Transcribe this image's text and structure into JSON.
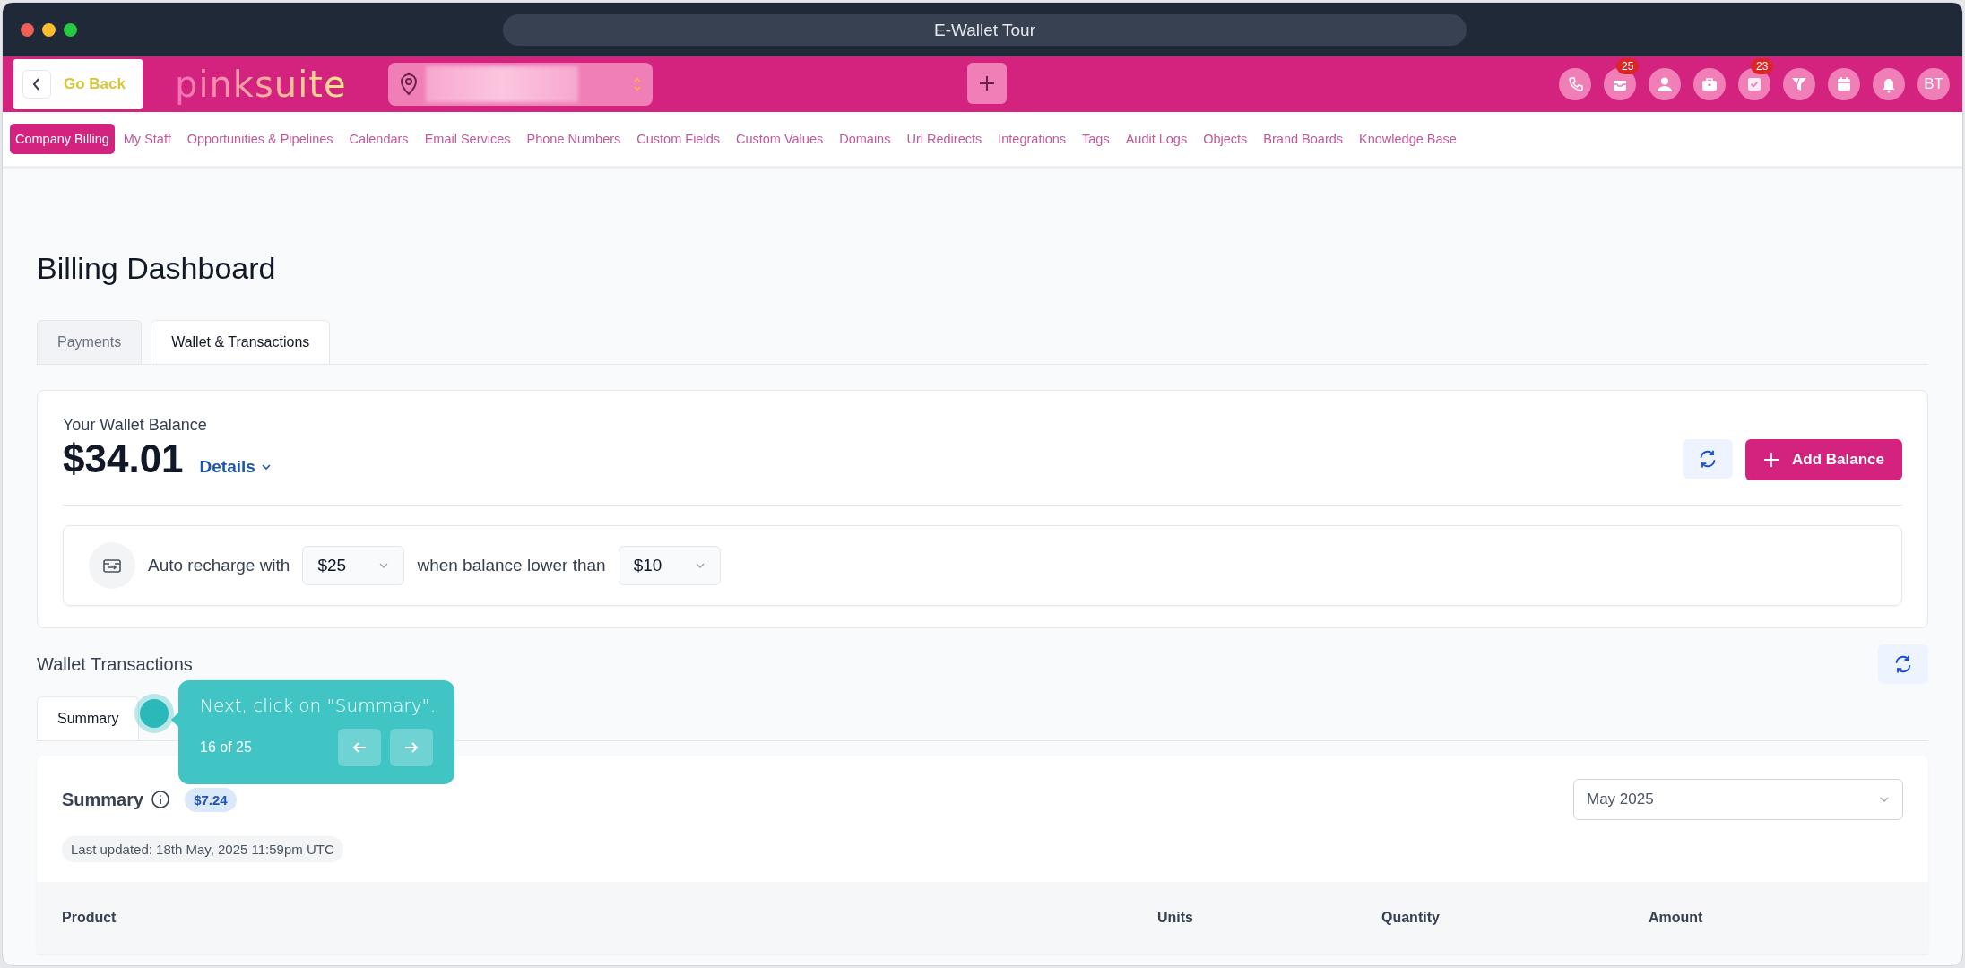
{
  "window": {
    "title": "E-Wallet Tour"
  },
  "header": {
    "back_label": "Go Back",
    "logo": "pinksuite",
    "icons": [
      {
        "kind": "phone"
      },
      {
        "kind": "inbox",
        "badge": "25"
      },
      {
        "kind": "user"
      },
      {
        "kind": "briefcase"
      },
      {
        "kind": "task",
        "badge": "23"
      },
      {
        "kind": "filter"
      },
      {
        "kind": "calendar"
      },
      {
        "kind": "bell"
      }
    ],
    "avatar": "BT"
  },
  "nav": [
    {
      "label": "Company Billing",
      "selected": true
    },
    {
      "label": "My Staff",
      "selected": false
    },
    {
      "label": "Opportunities & Pipelines",
      "selected": false
    },
    {
      "label": "Calendars",
      "selected": false
    },
    {
      "label": "Email Services",
      "selected": false
    },
    {
      "label": "Phone Numbers",
      "selected": false
    },
    {
      "label": "Custom Fields",
      "selected": false
    },
    {
      "label": "Custom Values",
      "selected": false
    },
    {
      "label": "Domains",
      "selected": false
    },
    {
      "label": "Url Redirects",
      "selected": false
    },
    {
      "label": "Integrations",
      "selected": false
    },
    {
      "label": "Tags",
      "selected": false
    },
    {
      "label": "Audit Logs",
      "selected": false
    },
    {
      "label": "Objects",
      "selected": false
    },
    {
      "label": "Brand Boards",
      "selected": false
    },
    {
      "label": "Knowledge Base",
      "selected": false
    }
  ],
  "page": {
    "title": "Billing Dashboard",
    "tabs": [
      {
        "label": "Payments",
        "selected": false
      },
      {
        "label": "Wallet & Transactions",
        "selected": true
      }
    ]
  },
  "wallet": {
    "label": "Your Wallet Balance",
    "amount": "$34.01",
    "details": "Details",
    "add_button": "Add Balance",
    "auto_prefix": "Auto recharge with",
    "recharge_amount": "$25",
    "auto_middle": "when balance lower than",
    "threshold": "$10"
  },
  "transactions": {
    "title": "Wallet Transactions",
    "tabs": [
      {
        "label": "Summary",
        "selected": true
      }
    ],
    "summary": {
      "title": "Summary",
      "total": "$7.24",
      "updated": "Last updated: 18th May, 2025 11:59pm UTC",
      "month": "May 2025"
    },
    "table": {
      "columns": [
        "Product",
        "Units",
        "Quantity",
        "Amount"
      ]
    }
  },
  "tour": {
    "text": "Next, click on \"Summary\".",
    "step": "16 of 25"
  }
}
